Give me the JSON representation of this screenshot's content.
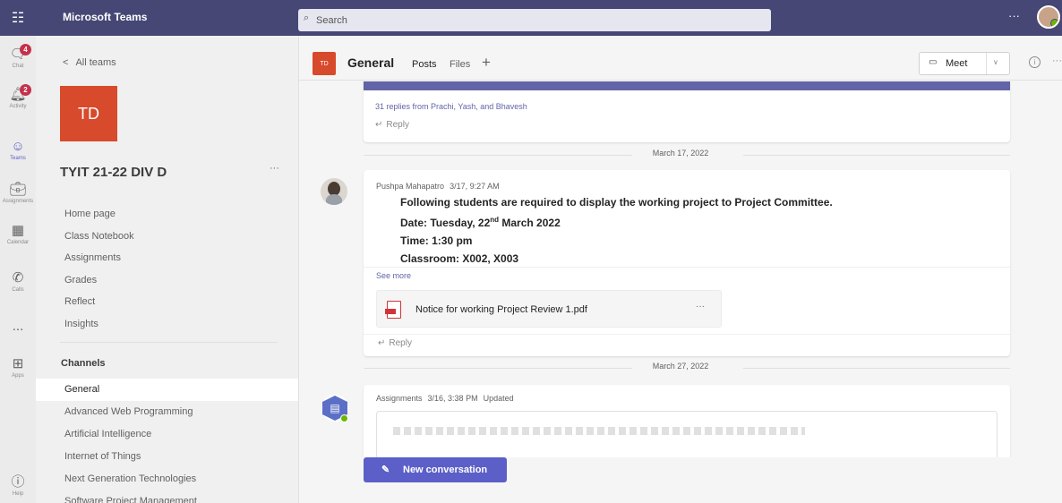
{
  "app": {
    "title": "Microsoft Teams"
  },
  "search": {
    "placeholder": "Search"
  },
  "rail": {
    "items": [
      {
        "label": "Chat",
        "badge": "4"
      },
      {
        "label": "Activity",
        "badge": "2"
      },
      {
        "label": "Teams"
      },
      {
        "label": "Assignments"
      },
      {
        "label": "Calendar"
      },
      {
        "label": "Calls"
      },
      {
        "label": "..."
      },
      {
        "label": "Apps"
      },
      {
        "label": "Help"
      }
    ]
  },
  "team_panel": {
    "back_label": "All teams",
    "team_initials": "TD",
    "team_name": "TYIT 21-22 DIV D",
    "nav": [
      "Home page",
      "Class Notebook",
      "Assignments",
      "Grades",
      "Reflect",
      "Insights"
    ],
    "channels_label": "Channels",
    "channels": [
      "General",
      "Advanced Web Programming",
      "Artificial Intelligence",
      "Internet of Things",
      "Next Generation Technologies",
      "Software Project Management"
    ]
  },
  "channel_header": {
    "avatar": "TD",
    "name": "General",
    "tabs": [
      "Posts",
      "Files"
    ],
    "meet_label": "Meet"
  },
  "feed": {
    "thread1": {
      "replies": "31 replies from Prachi, Yash, and Bhavesh",
      "reply_label": "Reply"
    },
    "date1": "March 17, 2022",
    "post1": {
      "author": "Pushpa Mahapatro",
      "time": "3/17, 9:27 AM",
      "line1": "Following students are required to display the working project to Project Committee.",
      "line2_prefix": "Date: Tuesday, 22",
      "line2_sup": "nd",
      "line2_suffix": " March 2022",
      "line3": "Time: 1:30 pm",
      "line4": "Classroom: X002, X003",
      "see_more": "See more",
      "attachment": "Notice for working Project Review 1.pdf",
      "reply_label": "Reply"
    },
    "date2": "March 27, 2022",
    "post2": {
      "author": "Assignments",
      "time": "3/16, 3:38 PM",
      "status": "Updated"
    }
  },
  "compose": {
    "new_conversation": "New conversation"
  },
  "colors": {
    "topbar": "#464775",
    "accent": "#5b5fc7",
    "team_tile": "#d74a2b",
    "badge": "#c4314b",
    "presence": "#6bb700"
  }
}
